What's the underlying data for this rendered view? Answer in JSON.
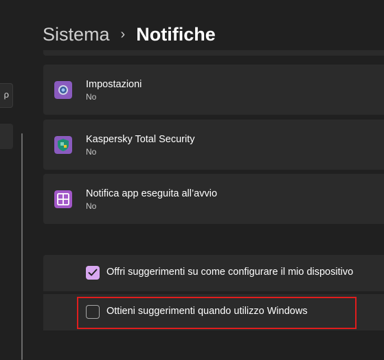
{
  "sidebar": {
    "search_partial_text": "ρ"
  },
  "breadcrumb": {
    "parent": "Sistema",
    "separator": "›",
    "current": "Notifiche"
  },
  "apps": [
    {
      "name": "Impostazioni",
      "status": "No",
      "icon": "gear-icon"
    },
    {
      "name": "Kaspersky Total Security",
      "status": "No",
      "icon": "kaspersky-shield-icon"
    },
    {
      "name": "Notifica app eseguita all’avvio",
      "status": "No",
      "icon": "startup-apps-icon"
    }
  ],
  "options": [
    {
      "label": "Offri suggerimenti su come configurare il mio dispositivo",
      "checked": true
    },
    {
      "label": "Ottieni suggerimenti quando utilizzo Windows",
      "checked": false
    }
  ],
  "colors": {
    "background": "#202020",
    "card": "#2b2b2b",
    "accent": "#d8a7f1",
    "highlight": "#e11d1d"
  }
}
